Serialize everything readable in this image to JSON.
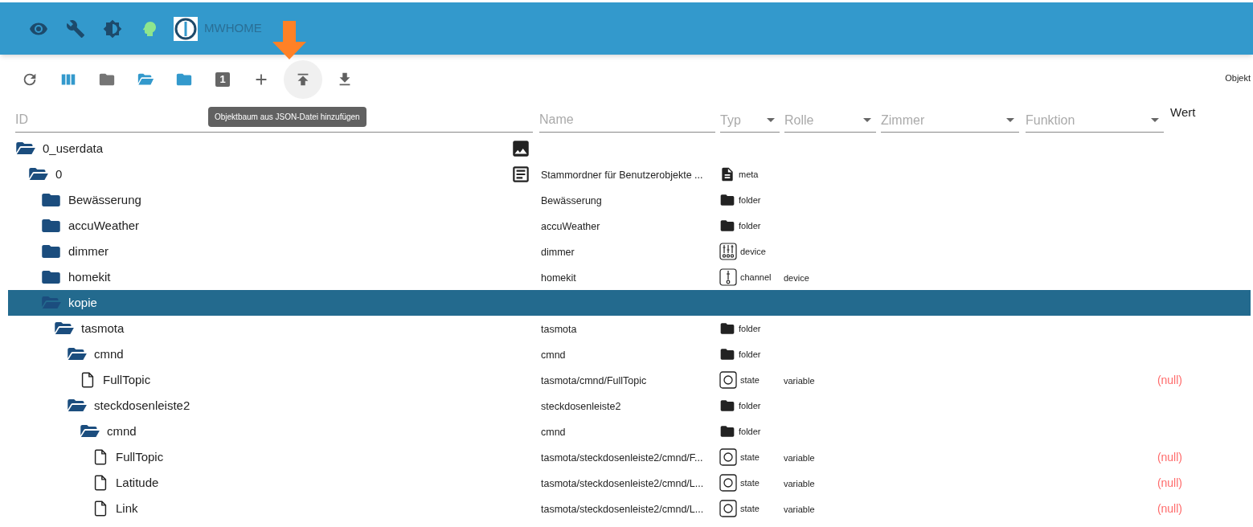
{
  "header": {
    "icons": [
      {
        "kind": "eye"
      },
      {
        "kind": "wrench"
      },
      {
        "kind": "brightness"
      },
      {
        "kind": "head"
      }
    ],
    "title": "MWHOME"
  },
  "toolbar": {
    "buttons": [
      {
        "kind": "refresh",
        "hovered": false
      },
      {
        "kind": "columns",
        "hovered": false
      },
      {
        "kind": "folder-closed",
        "hovered": false
      },
      {
        "kind": "folder-open",
        "hovered": false
      },
      {
        "kind": "folder-blue",
        "hovered": false
      },
      {
        "kind": "number",
        "label": "1",
        "hovered": false
      },
      {
        "kind": "add",
        "hovered": false
      },
      {
        "kind": "upload",
        "hovered": true
      },
      {
        "kind": "download",
        "hovered": false
      }
    ],
    "tooltip": "Objektbaum aus JSON-Datei hinzufügen",
    "right_text": "Objekt"
  },
  "filters": [
    {
      "kind": "text",
      "placeholder": "ID"
    },
    {
      "kind": "text",
      "placeholder": "Name"
    },
    {
      "kind": "select",
      "placeholder": "Typ"
    },
    {
      "kind": "select",
      "placeholder": "Rolle"
    },
    {
      "kind": "select",
      "placeholder": "Zimmer"
    },
    {
      "kind": "select",
      "placeholder": "Funktion"
    },
    {
      "kind": "label",
      "label": "Wert"
    }
  ],
  "tree": [
    {
      "id": "0_userdata",
      "kind": "folder",
      "expanded": true,
      "selected": false,
      "name_icon": {
        "kind": "image"
      },
      "children": [
        {
          "id": "0",
          "kind": "folder",
          "expanded": true,
          "selected": false,
          "name_icon": {
            "kind": "article"
          },
          "name": "Stammordner für Benutzerobjekte ...",
          "type": {
            "kind": "meta",
            "label": "meta"
          },
          "children": [
            {
              "id": "Bewässerung",
              "kind": "folder",
              "expanded": false,
              "selected": false,
              "name": "Bewässerung",
              "type": {
                "kind": "folder",
                "label": "folder"
              }
            },
            {
              "id": "accuWeather",
              "kind": "folder",
              "expanded": false,
              "selected": false,
              "name": "accuWeather",
              "type": {
                "kind": "folder",
                "label": "folder"
              }
            },
            {
              "id": "dimmer",
              "kind": "folder",
              "expanded": false,
              "selected": false,
              "name": "dimmer",
              "type": {
                "kind": "device",
                "label": "device"
              }
            },
            {
              "id": "homekit",
              "kind": "folder",
              "expanded": false,
              "selected": false,
              "name": "homekit",
              "type": {
                "kind": "channel",
                "label": "channel"
              },
              "role": "device"
            },
            {
              "id": "kopie",
              "kind": "folder",
              "expanded": true,
              "selected": true,
              "children": [
                {
                  "id": "tasmota",
                  "kind": "folder",
                  "expanded": true,
                  "selected": false,
                  "name": "tasmota",
                  "type": {
                    "kind": "folder",
                    "label": "folder"
                  },
                  "children": [
                    {
                      "id": "cmnd",
                      "kind": "folder",
                      "expanded": true,
                      "selected": false,
                      "name": "cmnd",
                      "type": {
                        "kind": "folder",
                        "label": "folder"
                      },
                      "children": [
                        {
                          "id": "FullTopic",
                          "kind": "state",
                          "selected": false,
                          "name": "tasmota/cmnd/FullTopic",
                          "type": {
                            "kind": "state",
                            "label": "state"
                          },
                          "role": "variable",
                          "value": "(null)"
                        }
                      ]
                    },
                    {
                      "id": "steckdosenleiste2",
                      "kind": "folder",
                      "expanded": true,
                      "selected": false,
                      "name": "steckdosenleiste2",
                      "type": {
                        "kind": "folder",
                        "label": "folder"
                      },
                      "children": [
                        {
                          "id": "cmnd",
                          "kind": "folder",
                          "expanded": true,
                          "selected": false,
                          "name": "cmnd",
                          "type": {
                            "kind": "folder",
                            "label": "folder"
                          },
                          "children": [
                            {
                              "id": "FullTopic",
                              "kind": "state",
                              "selected": false,
                              "name": "tasmota/steckdosenleiste2/cmnd/F...",
                              "type": {
                                "kind": "state",
                                "label": "state"
                              },
                              "role": "variable",
                              "value": "(null)"
                            },
                            {
                              "id": "Latitude",
                              "kind": "state",
                              "selected": false,
                              "name": "tasmota/steckdosenleiste2/cmnd/L...",
                              "type": {
                                "kind": "state",
                                "label": "state"
                              },
                              "role": "variable",
                              "value": "(null)"
                            },
                            {
                              "id": "Link",
                              "kind": "state",
                              "selected": false,
                              "name": "tasmota/steckdosenleiste2/cmnd/L...",
                              "type": {
                                "kind": "state",
                                "label": "state"
                              },
                              "role": "variable",
                              "value": "(null)"
                            }
                          ]
                        }
                      ]
                    }
                  ]
                }
              ]
            }
          ]
        }
      ]
    }
  ]
}
